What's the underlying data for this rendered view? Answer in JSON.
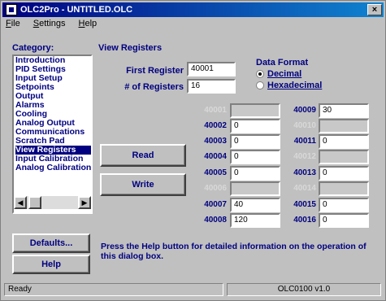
{
  "window": {
    "title": "OLC2Pro - UNTITLED.OLC",
    "close_glyph": "×"
  },
  "menu": [
    "File",
    "Settings",
    "Help"
  ],
  "category": {
    "label": "Category:",
    "items": [
      "Introduction",
      "PID Settings",
      "Input Setup",
      "Setpoints",
      "Output",
      "Alarms",
      "Cooling",
      "Analog Output",
      "Communications",
      "Scratch Pad",
      "View Registers",
      "Input Calibration",
      "Analog Calibration"
    ],
    "selected": "View Registers"
  },
  "buttons": {
    "defaults": "Defaults...",
    "help": "Help",
    "read": "Read",
    "write": "Write"
  },
  "view_registers": {
    "heading": "View Registers",
    "first_register_label": "First Register",
    "first_register_value": "40001",
    "num_registers_label": "# of Registers",
    "num_registers_value": "16"
  },
  "data_format": {
    "label": "Data Format",
    "options": [
      "Decimal",
      "Hexadecimal"
    ],
    "selected": "Decimal"
  },
  "registers": [
    {
      "label": "40001",
      "value": "",
      "enabled": false
    },
    {
      "label": "40002",
      "value": "0",
      "enabled": true
    },
    {
      "label": "40003",
      "value": "0",
      "enabled": true
    },
    {
      "label": "40004",
      "value": "0",
      "enabled": true
    },
    {
      "label": "40005",
      "value": "0",
      "enabled": true
    },
    {
      "label": "40006",
      "value": "",
      "enabled": false
    },
    {
      "label": "40007",
      "value": "40",
      "enabled": true
    },
    {
      "label": "40008",
      "value": "120",
      "enabled": true
    },
    {
      "label": "40009",
      "value": "30",
      "enabled": true
    },
    {
      "label": "40010",
      "value": "",
      "enabled": false
    },
    {
      "label": "40011",
      "value": "0",
      "enabled": true
    },
    {
      "label": "40012",
      "value": "",
      "enabled": false
    },
    {
      "label": "40013",
      "value": "0",
      "enabled": true
    },
    {
      "label": "40014",
      "value": "",
      "enabled": false
    },
    {
      "label": "40015",
      "value": "0",
      "enabled": true
    },
    {
      "label": "40016",
      "value": "0",
      "enabled": true
    }
  ],
  "help_text": "Press the Help button for detailed information on the operation of this dialog box.",
  "status": {
    "left": "Ready",
    "version": "OLC0100 v1.0"
  }
}
